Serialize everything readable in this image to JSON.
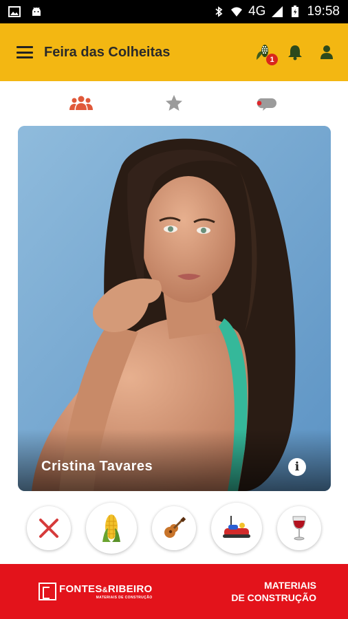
{
  "status_bar": {
    "network": "4G",
    "time": "19:58"
  },
  "app_bar": {
    "title": "Feira das Colheitas",
    "notification_badge": "1",
    "icons": [
      "menu-icon",
      "corn-icon",
      "bell-icon",
      "user-icon"
    ]
  },
  "tabs": [
    {
      "icon": "people-icon",
      "active": true,
      "color": "#e0593a"
    },
    {
      "icon": "star-icon",
      "active": false,
      "color": "#9b9b9b"
    },
    {
      "icon": "chat-icon",
      "active": false,
      "color": "#9b9b9b"
    }
  ],
  "profile": {
    "name": "Cristina Tavares",
    "info_label": "i"
  },
  "actions": [
    {
      "icon": "close-icon",
      "color": "#d63b3b"
    },
    {
      "icon": "corn-icon",
      "color": "#f2c12b"
    },
    {
      "icon": "guitar-icon",
      "color": "#c8742a"
    },
    {
      "icon": "bumper-car-icon",
      "color": "#d22b2b"
    },
    {
      "icon": "wine-glass-icon",
      "color": "#b3121f"
    }
  ],
  "ad": {
    "brand_left": "FONTES",
    "brand_amp": "&",
    "brand_right": "RIBEIRO",
    "brand_sub": "MATERIAIS DE CONSTRUÇÃO",
    "right_line1": "MATERIAIS",
    "right_line2": "DE CONSTRUÇÃO",
    "color": "#e3131b"
  },
  "colors": {
    "appbar": "#f3b712",
    "accent": "#e0593a"
  }
}
